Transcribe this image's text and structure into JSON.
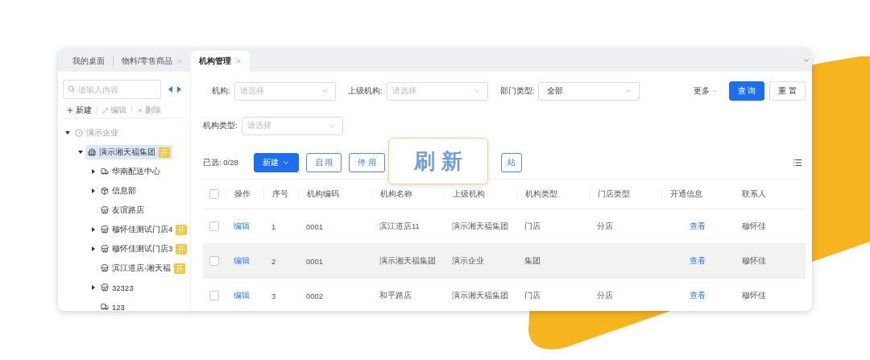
{
  "tabs": [
    {
      "label": "我的桌面",
      "closable": false,
      "selected": false
    },
    {
      "label": "物料/零售商品",
      "closable": true,
      "selected": false
    },
    {
      "label": "机构管理",
      "closable": true,
      "selected": true
    }
  ],
  "sidebar": {
    "search": {
      "placeholder": "请输入内容"
    },
    "actions": [
      {
        "label": "新建",
        "kind": "add",
        "disabled": false
      },
      {
        "label": "编辑",
        "kind": "edit",
        "disabled": true
      },
      {
        "label": "删除",
        "kind": "delete",
        "disabled": true
      }
    ],
    "tree": [
      {
        "label": "演示企业",
        "kind": "enterprise",
        "expanded": true,
        "selected": false,
        "children": [
          {
            "label": "演示湘天福集团",
            "kind": "group",
            "expanded": true,
            "selected": true,
            "badge": "开",
            "children": [
              {
                "label": "华南配送中心",
                "kind": "distribution",
                "expanded": false,
                "selected": false
              },
              {
                "label": "信息部",
                "kind": "department",
                "expanded": false,
                "selected": false
              },
              {
                "label": "友谊路店",
                "kind": "store",
                "selected": false
              },
              {
                "label": "穆怀佳测试门店4",
                "kind": "store",
                "expanded": false,
                "selected": false,
                "badge": "开"
              },
              {
                "label": "穆怀佳测试门店3",
                "kind": "store",
                "expanded": false,
                "selected": false,
                "badge": "开"
              },
              {
                "label": "滨江道店-湘天福",
                "kind": "store",
                "selected": false,
                "badge": "开"
              },
              {
                "label": "32323",
                "kind": "store",
                "expanded": false,
                "selected": false
              },
              {
                "label": "123",
                "kind": "distribution",
                "selected": false
              }
            ]
          }
        ]
      }
    ]
  },
  "filters": [
    {
      "label": "机构:",
      "placeholder": "请选择"
    },
    {
      "label": "上级机构:",
      "placeholder": "请选择"
    },
    {
      "label": "部门类型:",
      "value": "全部"
    },
    {
      "label": "机构类型:",
      "placeholder": "请选择"
    }
  ],
  "filter_actions": {
    "more": "更多",
    "query": "查 询",
    "reset": "重 置"
  },
  "toolbar": {
    "selected_count": "已选: 0/28",
    "buttons": [
      {
        "label": "新建",
        "kind": "primary"
      },
      {
        "label": "启 用",
        "kind": "default"
      },
      {
        "label": "停 用",
        "kind": "default"
      },
      {
        "label": "站",
        "kind": "default"
      }
    ]
  },
  "callout": {
    "text": "刷 新"
  },
  "table": {
    "all_checked": false,
    "columns": [
      "操作",
      "序号",
      "机构编码",
      "机构名称",
      "上级机构",
      "机构类型",
      "门店类型",
      "开通信息",
      "联系人"
    ],
    "rows": [
      {
        "checked": false,
        "hovered": false,
        "cells": [
          "编辑",
          "1",
          "0001",
          "滨江道店11",
          "演示湘天福集团",
          "门店",
          "分店",
          "查看",
          "穆怀佳"
        ]
      },
      {
        "checked": false,
        "hovered": true,
        "cells": [
          "编辑",
          "2",
          "0001",
          "演示湘天福集团",
          "演示企业",
          "集团",
          "",
          "查看",
          "穆怀佳"
        ]
      },
      {
        "checked": false,
        "hovered": false,
        "cells": [
          "编辑",
          "3",
          "0002",
          "和平路店",
          "演示湘天福集团",
          "门店",
          "分店",
          "查看",
          "穆怀佳"
        ]
      }
    ]
  }
}
